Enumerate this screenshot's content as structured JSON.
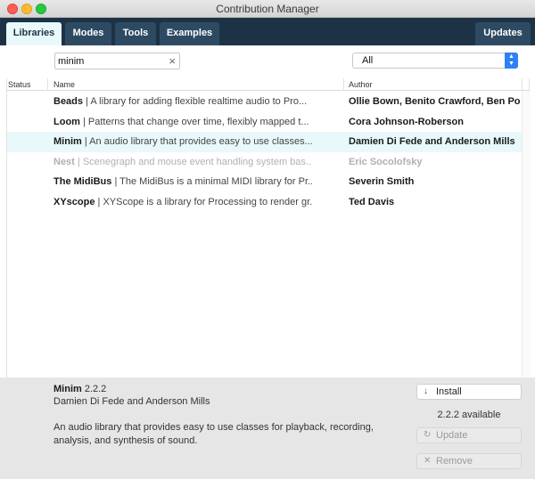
{
  "window": {
    "title": "Contribution Manager"
  },
  "tabs": [
    {
      "label": "Libraries"
    },
    {
      "label": "Modes"
    },
    {
      "label": "Tools"
    },
    {
      "label": "Examples"
    }
  ],
  "updates_tab": {
    "label": "Updates"
  },
  "filter": {
    "search_value": "minim",
    "clear_icon": "×",
    "category_selected": "All",
    "category_arrow": "▲▼"
  },
  "table": {
    "headers": {
      "status": "Status",
      "name": "Name",
      "author": "Author"
    },
    "rows": [
      {
        "name": "Beads",
        "description": " | A library for adding flexible realtime audio to Pro...",
        "author": "Ollie Bown, Benito Crawford, Ben Por..."
      },
      {
        "name": "Loom",
        "description": " | Patterns that change over time, flexibly mapped t...",
        "author": "Cora Johnson-Roberson"
      },
      {
        "name": "Minim",
        "description": " | An audio library that provides easy to use classes...",
        "author": "Damien Di Fede and Anderson Mills"
      },
      {
        "name": "Nest",
        "description": " | Scenegraph and mouse event handling system bas...",
        "author": "Eric Socolofsky"
      },
      {
        "name": "The MidiBus",
        "description": " | The MidiBus is a minimal MIDI library for Pr...",
        "author": "Severin Smith"
      },
      {
        "name": "XYscope",
        "description": " | XYScope is a library for Processing to render gr...",
        "author": "Ted Davis"
      }
    ]
  },
  "details": {
    "name": "Minim",
    "version": " 2.2.2",
    "author": "Damien Di Fede and Anderson Mills",
    "description": "An audio library that provides easy to use classes for playback, recording, analysis, and synthesis of sound.",
    "available": "2.2.2 available"
  },
  "buttons": {
    "install": {
      "label": "Install",
      "icon": "↓"
    },
    "update": {
      "label": "Update",
      "icon": "↻"
    },
    "remove": {
      "label": "Remove",
      "icon": "✕"
    }
  },
  "colors": {
    "tabbar": "#1e3246",
    "selected_row": "#e9f8fb",
    "select_accent": "#2f7ff5"
  }
}
